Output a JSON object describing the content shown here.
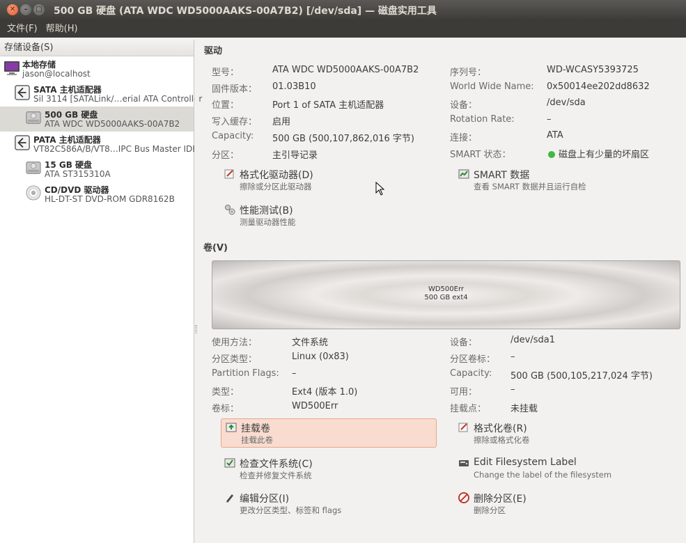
{
  "window": {
    "title": "500 GB 硬盘 (ATA WDC WD5000AAKS-00A7B2) [/dev/sda] — 磁盘实用工具"
  },
  "menu": {
    "file": "文件(F)",
    "help": "帮助(H)"
  },
  "sidebar": {
    "header": "存储设备(S)",
    "items": [
      {
        "title": "本地存储",
        "subtitle": "jason@localhost",
        "icon": "computer-icon"
      },
      {
        "title": "SATA 主机适配器",
        "subtitle": "Sil 3114 [SATALink/…erial ATA Controller",
        "icon": "adapter-icon"
      },
      {
        "title": "500 GB 硬盘",
        "subtitle": "ATA WDC WD5000AAKS-00A7B2",
        "icon": "hard-disk-icon"
      },
      {
        "title": "PATA 主机适配器",
        "subtitle": "VT82C586A/B/VT8…IPC Bus Master IDE",
        "icon": "adapter-icon"
      },
      {
        "title": "15 GB 硬盘",
        "subtitle": "ATA ST315310A",
        "icon": "hard-disk-icon"
      },
      {
        "title": "CD/DVD 驱动器",
        "subtitle": "HL-DT-ST DVD-ROM GDR8162B",
        "icon": "optical-drive-icon"
      }
    ]
  },
  "drive": {
    "section": "驱动",
    "left": [
      {
        "label": "型号：",
        "value": "ATA WDC WD5000AAKS-00A7B2"
      },
      {
        "label": "固件版本：",
        "value": "01.03B10"
      },
      {
        "label": "位置：",
        "value": "Port 1 of SATA 主机适配器"
      },
      {
        "label": "写入缓存：",
        "value": "启用"
      },
      {
        "label": "Capacity:",
        "value": "500 GB (500,107,862,016 字节)"
      },
      {
        "label": "分区：",
        "value": "主引导记录"
      }
    ],
    "right": [
      {
        "label": "序列号：",
        "value": "WD-WCASY5393725"
      },
      {
        "label": "World Wide Name:",
        "value": "0x50014ee202dd8632"
      },
      {
        "label": "设备：",
        "value": "/dev/sda"
      },
      {
        "label": "Rotation Rate:",
        "value": "–"
      },
      {
        "label": "连接：",
        "value": "ATA"
      },
      {
        "label": "SMART 状态：",
        "value": "磁盘上有少量的坏扇区"
      }
    ],
    "actions": {
      "format": {
        "label": "格式化驱动器(D)",
        "desc": "擦除或分区此驱动器"
      },
      "smart": {
        "label": "SMART 数据",
        "desc": "查看 SMART 数据并且运行自检"
      },
      "benchmark": {
        "label": "性能测试(B)",
        "desc": "测量驱动器性能"
      }
    }
  },
  "volumes": {
    "section": "卷(V)",
    "bar": {
      "name": "WD500Err",
      "detail": "500 GB ext4"
    },
    "left": [
      {
        "label": "使用方法：",
        "value": "文件系统"
      },
      {
        "label": "分区类型：",
        "value": "Linux (0x83)"
      },
      {
        "label": "Partition Flags:",
        "value": "–"
      },
      {
        "label": "类型：",
        "value": "Ext4 (版本 1.0)"
      },
      {
        "label": "卷标：",
        "value": "WD500Err"
      }
    ],
    "right": [
      {
        "label": "设备：",
        "value": "/dev/sda1"
      },
      {
        "label": "分区卷标：",
        "value": "–"
      },
      {
        "label": "Capacity:",
        "value": "500 GB (500,105,217,024 字节)"
      },
      {
        "label": "可用：",
        "value": "–"
      },
      {
        "label": "挂载点：",
        "value": "未挂载"
      }
    ],
    "actions": {
      "mount": {
        "label": "挂载卷",
        "desc": "挂载此卷"
      },
      "format_volume": {
        "label": "格式化卷(R)",
        "desc": "擦除或格式化卷"
      },
      "check_fs": {
        "label": "检查文件系统(C)",
        "desc": "检查并修复文件系统"
      },
      "edit_label": {
        "label": "Edit Filesystem Label",
        "desc": "Change the label of the filesystem"
      },
      "edit_partition": {
        "label": "编辑分区(I)",
        "desc": "更改分区类型、标签和 flags"
      },
      "delete_partition": {
        "label": "删除分区(E)",
        "desc": "删除分区"
      }
    }
  },
  "colors": {
    "accent": "#e2562b",
    "smart_ok": "#3fb93f",
    "selection": "#dcdad5",
    "active_action": "#f9dccf"
  }
}
